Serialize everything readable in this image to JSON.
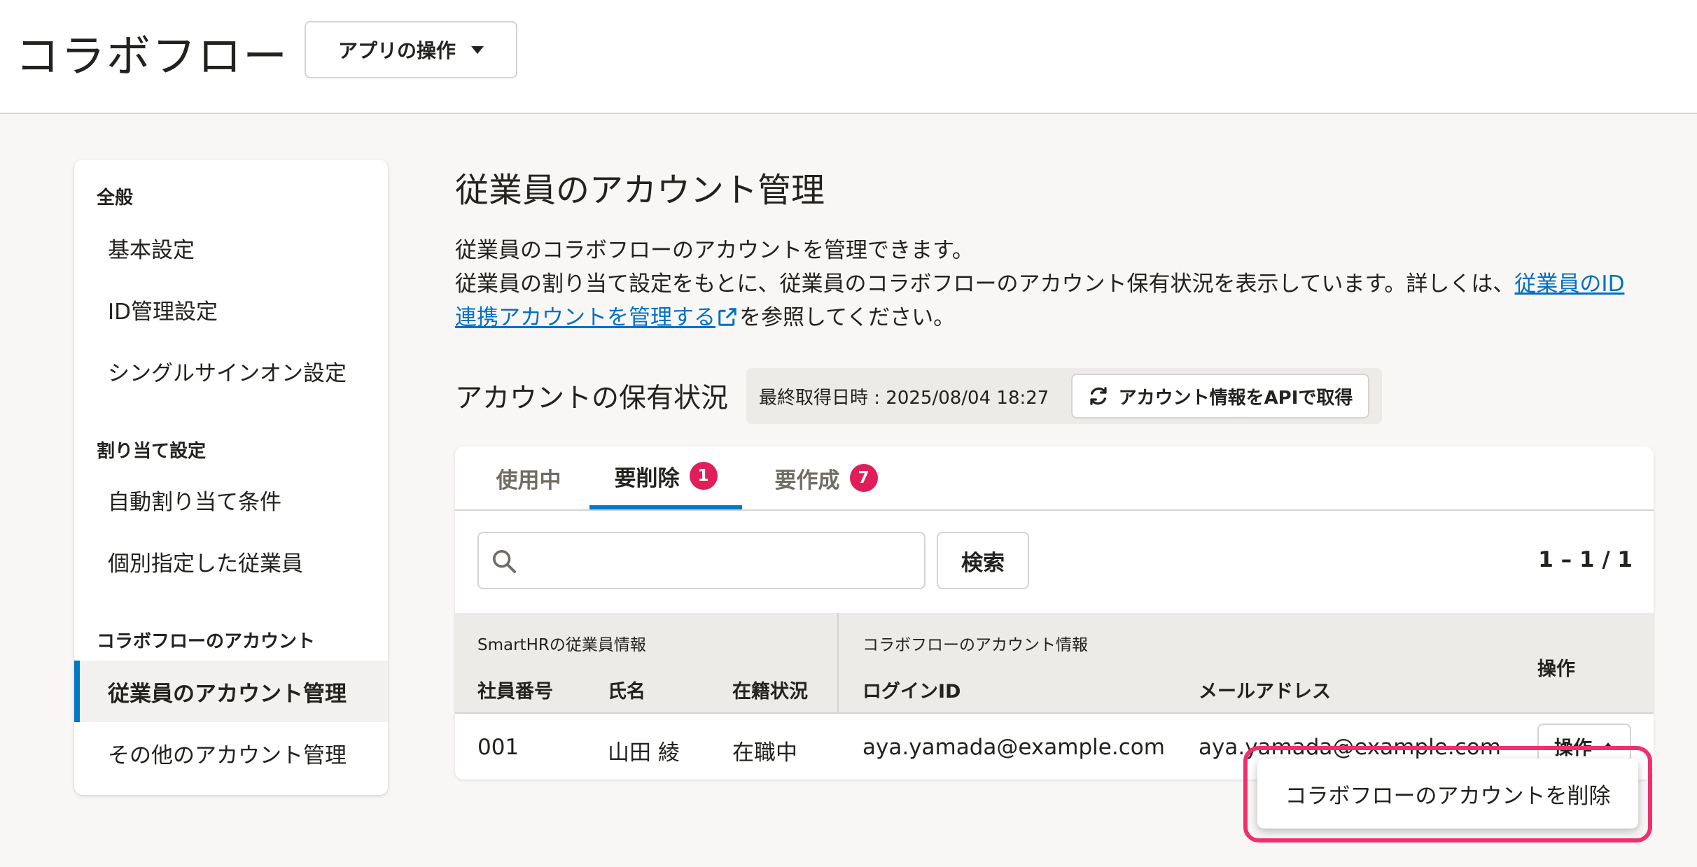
{
  "header": {
    "app_title": "コラボフロー",
    "app_ops_label": "アプリの操作"
  },
  "sidebar": {
    "groups": [
      {
        "label": "全般",
        "items": [
          {
            "label": "基本設定"
          },
          {
            "label": "ID管理設定"
          },
          {
            "label": "シングルサインオン設定"
          }
        ]
      },
      {
        "label": "割り当て設定",
        "items": [
          {
            "label": "自動割り当て条件"
          },
          {
            "label": "個別指定した従業員"
          }
        ]
      },
      {
        "label": "コラボフローのアカウント",
        "items": [
          {
            "label": "従業員のアカウント管理",
            "active": true
          },
          {
            "label": "その他のアカウント管理"
          }
        ]
      }
    ]
  },
  "main": {
    "title": "従業員のアカウント管理",
    "desc_line1": "従業員のコラボフローのアカウントを管理できます。",
    "desc_line2_prefix": "従業員の割り当て設定をもとに、従業員のコラボフローのアカウント保有状況を表示しています。詳しくは、",
    "desc_link": "従業員のID連携アカウントを管理する",
    "desc_suffix": "を参照してください。",
    "section_title": "アカウントの保有状況",
    "last_fetched": "最終取得日時 : 2025/08/04 18:27",
    "fetch_button": "アカウント情報をAPIで取得",
    "tabs": [
      {
        "label": "使用中",
        "badge": ""
      },
      {
        "label": "要削除",
        "badge": "1"
      },
      {
        "label": "要作成",
        "badge": "7"
      }
    ],
    "search_button": "検索",
    "search_value": "",
    "pager": "1 – 1 / 1",
    "table": {
      "group_smarthr": "SmartHRの従業員情報",
      "group_collabo": "コラボフローのアカウント情報",
      "col_emp_no": "社員番号",
      "col_name": "氏名",
      "col_status": "在籍状況",
      "col_login": "ログインID",
      "col_email": "メールアドレス",
      "col_ops": "操作",
      "rows": [
        {
          "emp_no": "001",
          "name": "山田 綾",
          "status": "在職中",
          "login": "aya.yamada@example.com",
          "email": "aya.yamada@example.com",
          "ops": "操作"
        }
      ]
    },
    "dropdown_item": "コラボフローのアカウントを削除"
  },
  "colors": {
    "accent": "#0077c7",
    "badge": "#e01e5a",
    "highlight": "#f0306e",
    "link": "#0071c1"
  }
}
